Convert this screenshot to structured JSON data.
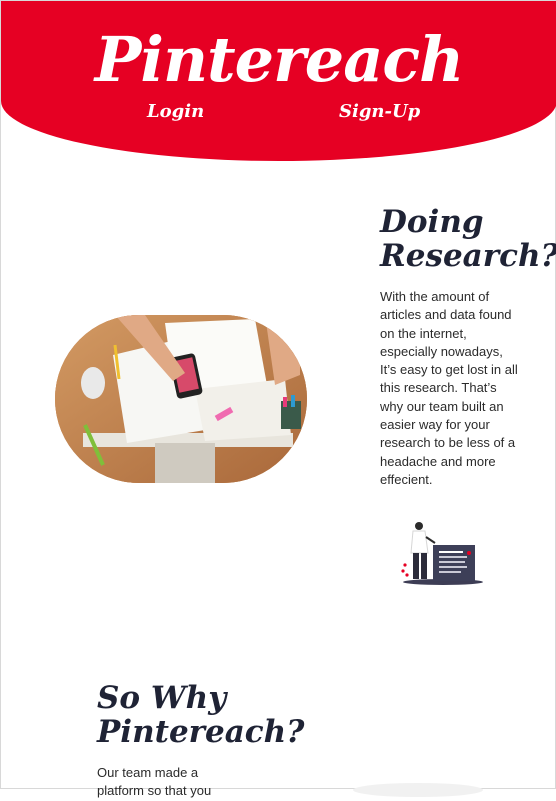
{
  "header": {
    "brand": "Pintereach",
    "nav": {
      "login": "Login",
      "signup": "Sign-Up"
    }
  },
  "section1": {
    "heading_line1": "Doing",
    "heading_line2": "Research?",
    "paragraph": "With the amount of articles and data found on the internet, especially nowadays, It’s easy to get lost in all this research. That’s why our team built an easier way for your research to be less of a headache and more effecient."
  },
  "section2": {
    "heading_line1": "So Why",
    "heading_line2": "Pintereach?",
    "paragraph": "Our team made a platform so that you"
  },
  "colors": {
    "brand": "#e60023",
    "heading": "#1f2335",
    "text": "#2b2b2b"
  },
  "icons": {
    "hero_photo": "desk-research-photo",
    "illustration": "person-with-presentation-board"
  }
}
